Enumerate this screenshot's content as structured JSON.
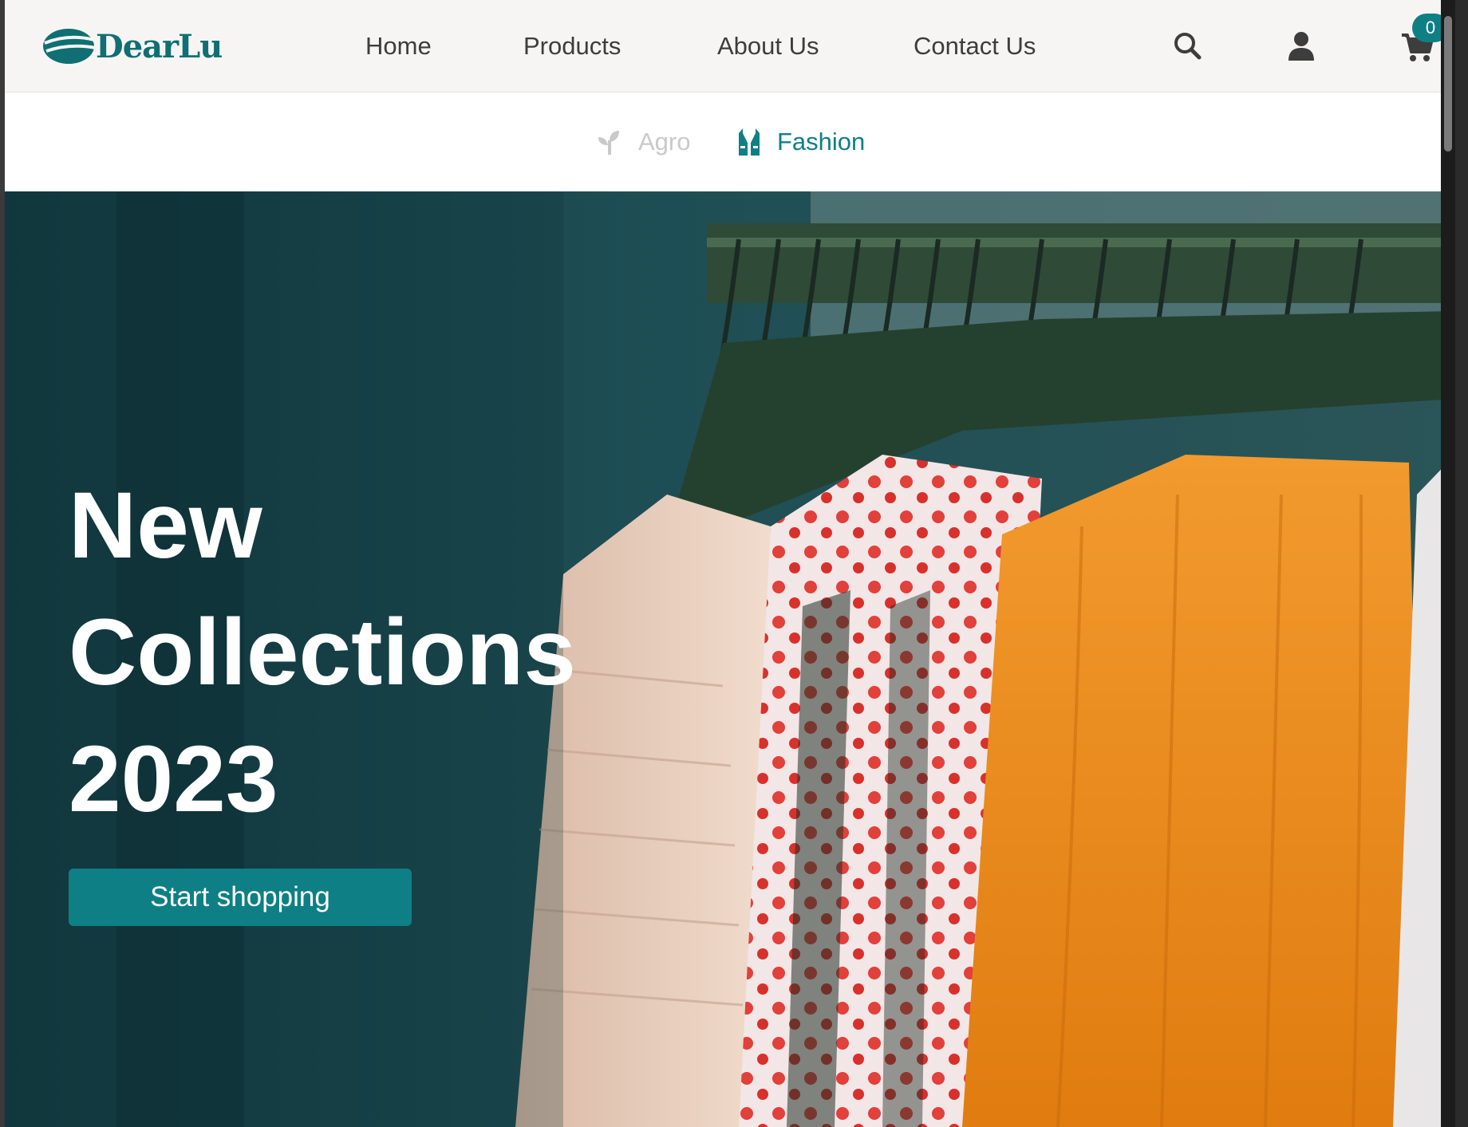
{
  "brand": {
    "name": "DearLu",
    "color": "#0f6f73"
  },
  "nav": {
    "links": [
      "Home",
      "Products",
      "About Us",
      "Contact Us"
    ]
  },
  "header_icons": {
    "search": "search-icon",
    "account": "user-icon",
    "cart": "cart-icon",
    "cart_count": "0"
  },
  "categories": [
    {
      "label": "Agro",
      "icon": "sprout-icon",
      "active": false
    },
    {
      "label": "Fashion",
      "icon": "vest-icon",
      "active": true
    }
  ],
  "hero": {
    "title_lines": [
      "New",
      "Collections",
      "2023"
    ],
    "cta_label": "Start shopping",
    "image": "clothing-rack-photo"
  },
  "colors": {
    "accent": "#0f7f86",
    "header_bg": "#f6f5f3",
    "hero_wall": "#17434a"
  }
}
